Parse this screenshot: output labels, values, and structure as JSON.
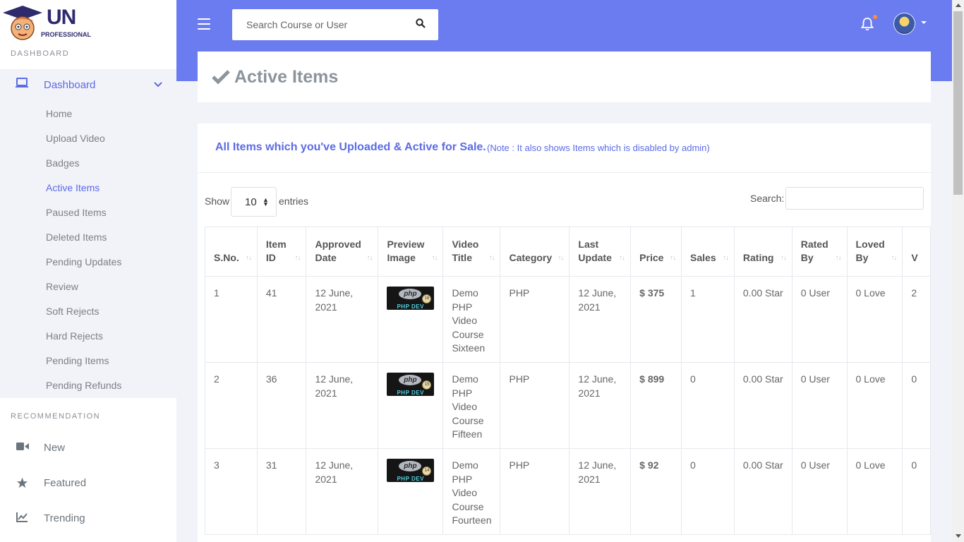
{
  "sidebar": {
    "logo": {
      "line1": "UN",
      "line2": "PROFESSIONAL"
    },
    "dashboard_section": "DASHBOARD",
    "dashboard_label": "Dashboard",
    "items": [
      {
        "label": "Home"
      },
      {
        "label": "Upload Video"
      },
      {
        "label": "Badges"
      },
      {
        "label": "Active Items",
        "active": true
      },
      {
        "label": "Paused Items"
      },
      {
        "label": "Deleted Items"
      },
      {
        "label": "Pending Updates"
      },
      {
        "label": "Review"
      },
      {
        "label": "Soft Rejects"
      },
      {
        "label": "Hard Rejects"
      },
      {
        "label": "Pending Items"
      },
      {
        "label": "Pending Refunds"
      }
    ],
    "recommendation_section": "RECOMMENDATION",
    "recommendation": [
      {
        "label": "New",
        "icon": "video-camera-icon"
      },
      {
        "label": "Featured",
        "icon": "star-icon"
      },
      {
        "label": "Trending",
        "icon": "chart-line-icon"
      }
    ]
  },
  "header": {
    "search_placeholder": "Search Course or User",
    "accent_color": "#6b7cf0",
    "notification_dot_color": "#ff8a3d"
  },
  "page": {
    "title": "Active Items",
    "subtitle": "All Items which you've Uploaded & Active for Sale.",
    "note": "(Note : It also shows Items which is disabled by admin)"
  },
  "table_controls": {
    "show_label": "Show",
    "entries_value": "10",
    "entries_label": "entries",
    "search_label": "Search:"
  },
  "table": {
    "columns": [
      {
        "line1": "S.No.",
        "line2": ""
      },
      {
        "line1": "Item",
        "line2": "ID"
      },
      {
        "line1": "Approved",
        "line2": "Date"
      },
      {
        "line1": "Preview",
        "line2": "Image"
      },
      {
        "line1": "Video",
        "line2": "Title"
      },
      {
        "line1": "Category",
        "line2": ""
      },
      {
        "line1": "Last",
        "line2": "Update"
      },
      {
        "line1": "Price",
        "line2": ""
      },
      {
        "line1": "Sales",
        "line2": ""
      },
      {
        "line1": "Rating",
        "line2": ""
      },
      {
        "line1": "Rated",
        "line2": "By"
      },
      {
        "line1": "Loved",
        "line2": "By"
      },
      {
        "line1": "V",
        "line2": ""
      }
    ],
    "rows": [
      {
        "sno": "1",
        "item_id": "41",
        "approved": "12 June, 2021",
        "preview_text": "php",
        "preview_sub": "PHP DEV",
        "preview_num": "16",
        "title": "Demo PHP Video Course Sixteen",
        "category": "PHP",
        "last_update": "12 June, 2021",
        "price": "$ 375",
        "sales": "1",
        "rating": "0.00 Star",
        "rated_by": "0 User",
        "loved_by": "0 Love",
        "v": "2"
      },
      {
        "sno": "2",
        "item_id": "36",
        "approved": "12 June, 2021",
        "preview_text": "php",
        "preview_sub": "PHP DEV",
        "preview_num": "15",
        "title": "Demo PHP Video Course Fifteen",
        "category": "PHP",
        "last_update": "12 June, 2021",
        "price": "$ 899",
        "sales": "0",
        "rating": "0.00 Star",
        "rated_by": "0 User",
        "loved_by": "0 Love",
        "v": "0"
      },
      {
        "sno": "3",
        "item_id": "31",
        "approved": "12 June, 2021",
        "preview_text": "php",
        "preview_sub": "PHP DEV",
        "preview_num": "14",
        "title": "Demo PHP Video Course Fourteen",
        "category": "PHP",
        "last_update": "12 June, 2021",
        "price": "$ 92",
        "sales": "0",
        "rating": "0.00 Star",
        "rated_by": "0 User",
        "loved_by": "0 Love",
        "v": "0"
      }
    ]
  }
}
